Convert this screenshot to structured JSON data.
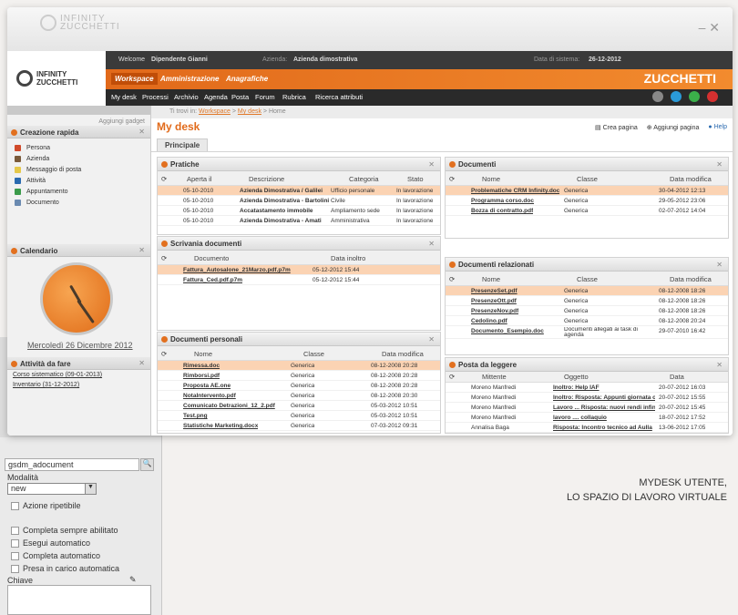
{
  "titlebar": {
    "brand_line1": "INFINITY",
    "brand_line2": "ZUCCHETTI",
    "controls": "– ✕"
  },
  "header": {
    "logo_line1": "INFINITY",
    "logo_line2": "ZUCCHETTI",
    "welcome_label": "Welcome",
    "user": "Dipendente Gianni",
    "company_label": "Azienda:",
    "company": "Azienda dimostrativa",
    "date_label": "Data di sistema:",
    "date": "26-12-2012",
    "tabs": [
      "Workspace",
      "Amministrazione",
      "Anagrafiche"
    ],
    "brand": "ZUCCHETTI",
    "menu": [
      "My desk",
      "Processi",
      "Archivio",
      "Agenda",
      "Posta",
      "Forum",
      "Rubrica",
      "Ricerca attributi"
    ]
  },
  "sidebar": {
    "add_gadget": "Aggiungi gadget",
    "quick_title": "Creazione rapida",
    "quick_items": [
      "Persona",
      "Azienda",
      "Messaggio di posta",
      "Attività",
      "Appuntamento",
      "Documento"
    ],
    "calendar_title": "Calendario",
    "calendar_date": "Mercoledì 26 Dicembre 2012",
    "todo_title": "Attività da fare",
    "todo_items": [
      "Corso sistematico (09-01-2013)",
      "Inventario (31-12-2012)"
    ]
  },
  "main": {
    "breadcrumb_prefix": "Ti trovi in:",
    "breadcrumb": [
      "Workspace",
      "My desk",
      "Home"
    ],
    "title": "My desk",
    "tools": [
      "Crea pagina",
      "Aggiungi pagina",
      "Help"
    ],
    "subtab": "Principale"
  },
  "pratiche": {
    "title": "Pratiche",
    "headers": [
      "Aperta il",
      "Descrizione",
      "Categoria",
      "Stato"
    ],
    "rows": [
      {
        "date": "05-10-2010",
        "desc": "Azienda Dimostrativa / Galilei",
        "cat": "Ufficio personale",
        "state": "In lavorazione"
      },
      {
        "date": "05-10-2010",
        "desc": "Azienda Dimostrativa - Bartolini",
        "cat": "Civile",
        "state": "In lavorazione"
      },
      {
        "date": "05-10-2010",
        "desc": "Accatastamento immobile",
        "cat": "Ampliamento sede",
        "state": "In lavorazione"
      },
      {
        "date": "05-10-2010",
        "desc": "Azienda Dimostrativa - Amati",
        "cat": "Amministrativa",
        "state": "In lavorazione"
      }
    ]
  },
  "scrivania": {
    "title": "Scrivania documenti",
    "headers": [
      "Documento",
      "Data inoltro"
    ],
    "rows": [
      {
        "doc": "Fattura_Autosalone_21Marzo.pdf.p7m",
        "date": "05-12-2012 15:44"
      },
      {
        "doc": "Fattura_Ced.pdf.p7m",
        "date": "05-12-2012 15:44"
      }
    ]
  },
  "personali": {
    "title": "Documenti personali",
    "headers": [
      "Nome",
      "Classe",
      "Data modifica"
    ],
    "rows": [
      {
        "name": "Rimessa.doc",
        "cls": "Generica",
        "date": "08-12-2008 20:28"
      },
      {
        "name": "Rimborsi.pdf",
        "cls": "Generica",
        "date": "08-12-2008 20:28"
      },
      {
        "name": "Proposta AE.one",
        "cls": "Generica",
        "date": "08-12-2008 20:28"
      },
      {
        "name": "NotaIntervento.pdf",
        "cls": "Generica",
        "date": "08-12-2008 20:30"
      },
      {
        "name": "Comunicato Detrazioni_12_2.pdf",
        "cls": "Generica",
        "date": "05-03-2012 10:51"
      },
      {
        "name": "Test.png",
        "cls": "Generica",
        "date": "05-03-2012 10:51"
      },
      {
        "name": "Statistiche Marketing.docx",
        "cls": "Generica",
        "date": "07-03-2012 09:31"
      }
    ]
  },
  "documenti": {
    "title": "Documenti",
    "headers": [
      "Nome",
      "Classe",
      "Data modifica"
    ],
    "rows": [
      {
        "name": "Problematiche CRM Infinity.doc",
        "cls": "Generica",
        "date": "30-04-2012 12:13"
      },
      {
        "name": "Programma corso.doc",
        "cls": "Generica",
        "date": "29-05-2012 23:06"
      },
      {
        "name": "Bozza di contratto.pdf",
        "cls": "Generica",
        "date": "02-07-2012 14:04"
      }
    ]
  },
  "relazionati": {
    "title": "Documenti relazionati",
    "headers": [
      "Nome",
      "Classe",
      "Data modifica"
    ],
    "rows": [
      {
        "name": "PresenzeSet.pdf",
        "cls": "Generica",
        "date": "08-12-2008 18:26"
      },
      {
        "name": "PresenzeOtt.pdf",
        "cls": "Generica",
        "date": "08-12-2008 18:26"
      },
      {
        "name": "PresenzeNov.pdf",
        "cls": "Generica",
        "date": "08-12-2008 18:26"
      },
      {
        "name": "Cedolino.pdf",
        "cls": "Generica",
        "date": "08-12-2008 20:24"
      },
      {
        "name": "Documento_Esempio.doc",
        "cls": "Documenti allegati ai task di agenda",
        "date": "29-07-2010 16:42"
      }
    ]
  },
  "posta": {
    "title": "Posta da leggere",
    "headers": [
      "Mittente",
      "Oggetto",
      "Data"
    ],
    "rows": [
      {
        "from": "Moreno Manfredi",
        "subj": "Inoltro: Help IAF",
        "date": "20-07-2012 16:03"
      },
      {
        "from": "Moreno Manfredi",
        "subj": "Inoltro: Risposta: Appunti giornata odierna in ambito CRM",
        "date": "20-07-2012 15:55"
      },
      {
        "from": "Moreno Manfredi",
        "subj": "Lavoro ... Risposta: nuovi rendi infiniti",
        "date": "20-07-2012 15:45"
      },
      {
        "from": "Moreno Manfredi",
        "subj": "lavoro .... collaquio",
        "date": "18-07-2012 17:52"
      },
      {
        "from": "Annalisa Baga",
        "subj": "Risposta: Incontro tecnico ad Aulla",
        "date": "13-06-2012 17:05"
      }
    ]
  },
  "background": {
    "field_value": "gsdm_adocument",
    "modality_label": "Modalità",
    "modality_value": "new",
    "checkboxes": [
      "Azione ripetibile",
      "Completa sempre abilitato",
      "Esegui automatico",
      "Completa automatico",
      "Presa in carico automatica"
    ],
    "key_label": "Chiave"
  },
  "caption": {
    "line1": "MYDESK UTENTE,",
    "line2": "LO SPAZIO DI LAVORO VIRTUALE"
  },
  "colors": {
    "accent": "#e1691a",
    "selected_row": "#fbd3b3",
    "dark_bar": "#2a2a2a"
  }
}
